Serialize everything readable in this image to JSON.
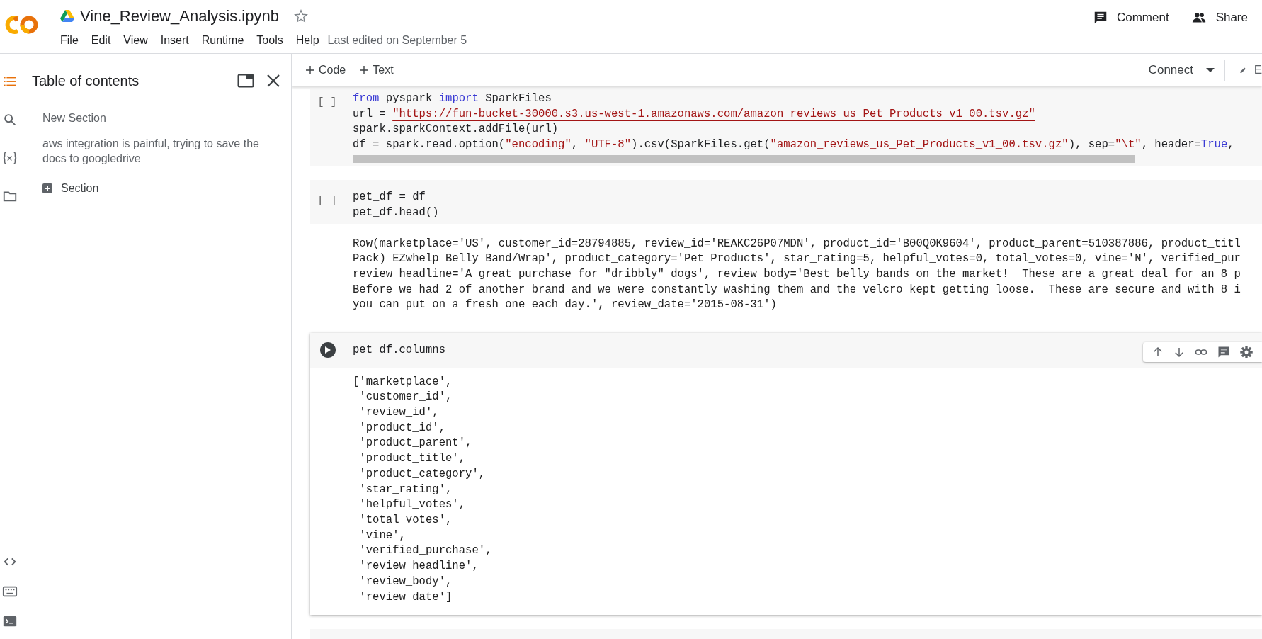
{
  "header": {
    "title": "Vine_Review_Analysis.ipynb",
    "menu": [
      "File",
      "Edit",
      "View",
      "Insert",
      "Runtime",
      "Tools",
      "Help"
    ],
    "last_edited": "Last edited on September 5",
    "actions": [
      {
        "kind": "comment",
        "label": "Comment"
      },
      {
        "kind": "share",
        "label": "Share"
      }
    ]
  },
  "toolbar": {
    "add_buttons": [
      "Code",
      "Text"
    ],
    "connect": "Connect",
    "edit": "E"
  },
  "sidebar": {
    "rail": [
      {
        "kind": "toc",
        "selected": true
      },
      {
        "kind": "search",
        "selected": false
      },
      {
        "kind": "variables",
        "selected": false
      },
      {
        "kind": "files",
        "selected": false
      }
    ],
    "rail_bottom": [
      {
        "kind": "code"
      },
      {
        "kind": "keyboard"
      },
      {
        "kind": "terminal"
      }
    ],
    "title": "Table of contents",
    "items": [
      "New Section",
      "aws integration is painful, trying to save the docs to googledrive"
    ],
    "add_section": "Section"
  },
  "cells": [
    {
      "focused": false,
      "execution_count": "[ ]",
      "scrollbar": true,
      "code": [
        [
          {
            "kind": "keyword",
            "text": "from"
          },
          {
            "kind": "plain",
            "text": " pyspark "
          },
          {
            "kind": "keyword",
            "text": "import"
          },
          {
            "kind": "plain",
            "text": " SparkFiles"
          }
        ],
        [
          {
            "kind": "plain",
            "text": "url = "
          },
          {
            "kind": "link",
            "text": "\"https://fun-bucket-30000.s3.us-west-1.amazonaws.com/amazon_reviews_us_Pet_Products_v1_00.tsv.gz\""
          }
        ],
        [
          {
            "kind": "plain",
            "text": "spark.sparkContext.addFile(url)"
          }
        ],
        [
          {
            "kind": "plain",
            "text": "df = spark.read.option("
          },
          {
            "kind": "string",
            "text": "\"encoding\""
          },
          {
            "kind": "plain",
            "text": ", "
          },
          {
            "kind": "string",
            "text": "\"UTF-8\""
          },
          {
            "kind": "plain",
            "text": ").csv(SparkFiles.get("
          },
          {
            "kind": "string",
            "text": "\"amazon_reviews_us_Pet_Products_v1_00.tsv.gz\""
          },
          {
            "kind": "plain",
            "text": "), sep="
          },
          {
            "kind": "string",
            "text": "\"\\t\""
          },
          {
            "kind": "plain",
            "text": ", header="
          },
          {
            "kind": "keyword",
            "text": "True"
          },
          {
            "kind": "plain",
            "text": ","
          }
        ]
      ]
    },
    {
      "focused": false,
      "execution_count": "[ ]",
      "scrollbar": false,
      "code": [
        [
          {
            "kind": "plain",
            "text": "pet_df = df"
          }
        ],
        [
          {
            "kind": "plain",
            "text": "pet_df.head()"
          }
        ]
      ],
      "output": [
        "Row(marketplace='US', customer_id=28794885, review_id='REAKC26P07MDN', product_id='B00Q0K9604', product_parent=510387886, product_titl",
        "Pack) EZwhelp Belly Band/Wrap', product_category='Pet Products', star_rating=5, helpful_votes=0, total_votes=0, vine='N', verified_pur",
        "review_headline='A great purchase for \"dribbly\" dogs', review_body='Best belly bands on the market!  These are a great deal for an 8 p",
        "Before we had 2 of another brand and we were constantly washing them and the velcro kept getting loose.  These are secure and with 8 i",
        "you can put on a fresh one each day.', review_date='2015-08-31')"
      ]
    },
    {
      "focused": true,
      "scrollbar": false,
      "code": [
        [
          {
            "kind": "plain",
            "text": "pet_df.columns"
          }
        ]
      ],
      "output": [
        "['marketplace',",
        " 'customer_id',",
        " 'review_id',",
        " 'product_id',",
        " 'product_parent',",
        " 'product_title',",
        " 'product_category',",
        " 'star_rating',",
        " 'helpful_votes',",
        " 'total_votes',",
        " 'vine',",
        " 'verified_purchase',",
        " 'review_headline',",
        " 'review_body',",
        " 'review_date']"
      ]
    }
  ]
}
